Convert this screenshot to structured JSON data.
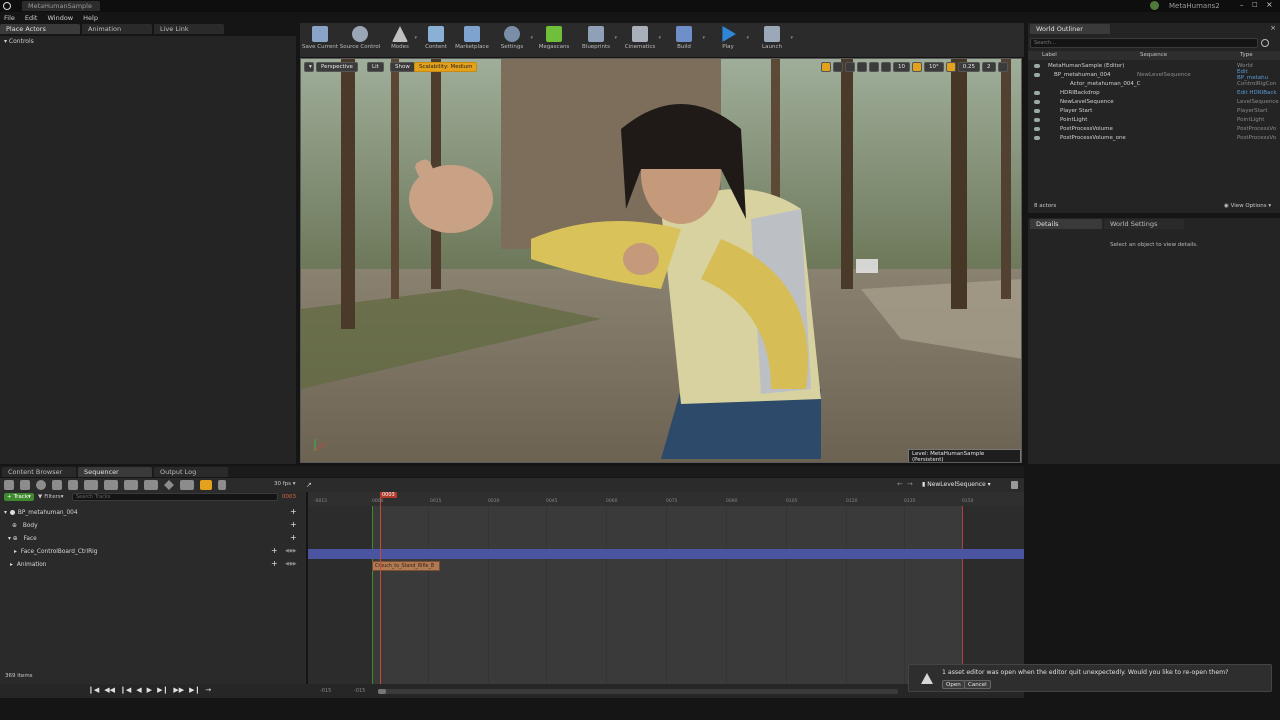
{
  "titlebar": {
    "tab_label": "MetaHumanSample",
    "project_name": "MetaHumans2"
  },
  "menu": [
    "File",
    "Edit",
    "Window",
    "Help"
  ],
  "left_tabs": {
    "place_actors": "Place Actors",
    "animation": "Animation",
    "live_link": "Live Link",
    "controls": "Controls"
  },
  "toolbar": [
    {
      "label": "Save Current",
      "icon": "save-icon"
    },
    {
      "label": "Source Control",
      "icon": "source-control-icon"
    },
    {
      "label": "Modes",
      "icon": "modes-icon"
    },
    {
      "label": "Content",
      "icon": "content-icon"
    },
    {
      "label": "Marketplace",
      "icon": "marketplace-icon"
    },
    {
      "label": "Settings",
      "icon": "gear-icon"
    },
    {
      "label": "Megascans",
      "icon": "megascans-icon"
    },
    {
      "label": "Blueprints",
      "icon": "blueprints-icon"
    },
    {
      "label": "Cinematics",
      "icon": "clapper-icon"
    },
    {
      "label": "Build",
      "icon": "build-icon"
    },
    {
      "label": "Play",
      "icon": "play-icon"
    },
    {
      "label": "Launch",
      "icon": "launch-icon"
    }
  ],
  "viewport": {
    "perspective": "Perspective",
    "lit": "Lit",
    "show": "Show",
    "scalability": "Scalability: Medium",
    "snap_value": "0.25",
    "camera_speed": "2",
    "grid_value": "10",
    "angle_value": "10°",
    "level_label": "Level:  MetaHumanSample (Persistent)"
  },
  "outliner": {
    "title": "World Outliner",
    "search_placeholder": "Search...",
    "columns": {
      "label": "Label",
      "sequence": "Sequence",
      "type": "Type"
    },
    "rows": [
      {
        "label": "MetaHumanSample (Editor)",
        "sequence": "",
        "type": "World"
      },
      {
        "label": "BP_metahuman_004",
        "sequence": "NewLevelSequence",
        "type": "Edit BP_metahu"
      },
      {
        "label": "Actor_metahuman_004_C",
        "sequence": "",
        "type": "ControlRigCon"
      },
      {
        "label": "HDRIBackdrop",
        "sequence": "",
        "type": "Edit HDRIBack"
      },
      {
        "label": "NewLevelSequence",
        "sequence": "",
        "type": "LevelSequence"
      },
      {
        "label": "Player Start",
        "sequence": "",
        "type": "PlayerStart"
      },
      {
        "label": "PointLight",
        "sequence": "",
        "type": "PointLight"
      },
      {
        "label": "PostProcessVolume",
        "sequence": "",
        "type": "PostProcessVo"
      },
      {
        "label": "PostProcessVolume_one",
        "sequence": "",
        "type": "PostProcessVo"
      }
    ],
    "actor_count": "8 actors",
    "view_options": "View Options"
  },
  "details": {
    "tab_details": "Details",
    "tab_world_settings": "World Settings",
    "empty_message": "Select an object to view details."
  },
  "bottom_tabs": {
    "content_browser": "Content Browser",
    "sequencer": "Sequencer",
    "output_log": "Output Log"
  },
  "sequencer": {
    "track_button": "Track",
    "filters_button": "Filters",
    "search_placeholder": "Search Tracks",
    "fps": "30 fps",
    "sequence_name": "NewLevelSequence",
    "frame_counter": "0003",
    "current_frame": "0003",
    "ruler_ticks": [
      "-0015",
      "0000",
      "0015",
      "0030",
      "0045",
      "0060",
      "0075",
      "0090",
      "0105",
      "0120",
      "0135",
      "0150"
    ],
    "tracks": [
      {
        "label": "BP_metahuman_004",
        "indent": 0
      },
      {
        "label": "Body",
        "indent": 1
      },
      {
        "label": "Face",
        "indent": 1
      },
      {
        "label": "Face_ControlBoard_CtrlRig",
        "indent": 2
      },
      {
        "label": "Animation",
        "indent": 2
      }
    ],
    "clip_label": "Crouch_to_Stand_Rifle_B",
    "start_frame": "-015",
    "end_frame": "-015",
    "items_count": "369 items"
  },
  "notification": {
    "message": "1 asset editor was open when the editor quit unexpectedly. Would you like to re-open them?",
    "open": "Open",
    "cancel": "Cancel"
  },
  "colors": {
    "accent_orange": "#e4a11b",
    "megascans_green": "#6fbf3a",
    "play_blue": "#2f86d6",
    "track_blue": "#4a54a0",
    "clip_orange": "#b07a55"
  }
}
